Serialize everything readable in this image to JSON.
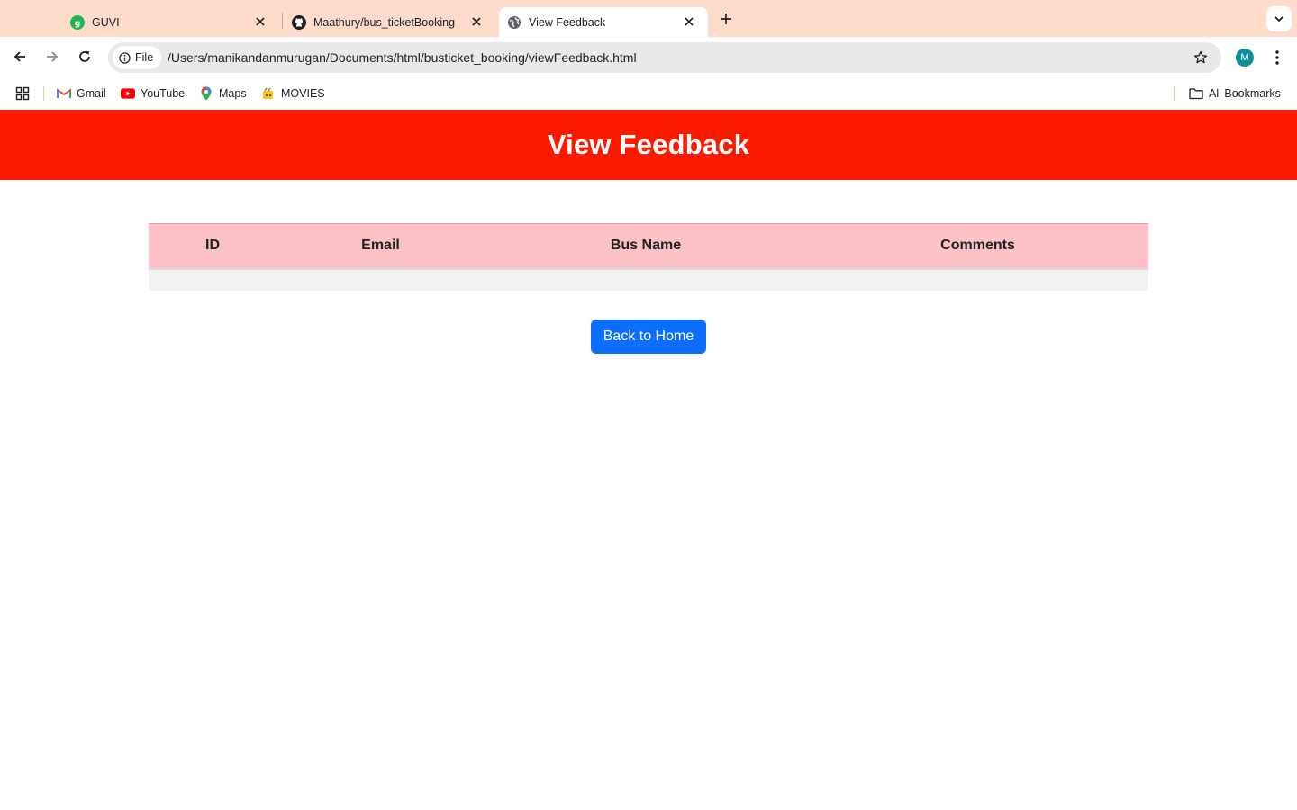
{
  "browser": {
    "tabs": [
      {
        "title": "GUVI",
        "icon": "guvi-logo-icon",
        "active": false
      },
      {
        "title": "Maathury/bus_ticketBooking",
        "icon": "github-icon",
        "active": false
      },
      {
        "title": "View Feedback",
        "icon": "globe-icon",
        "active": true
      }
    ],
    "address_bar": {
      "chip_label": "File",
      "url": "/Users/manikandanmurugan/Documents/html/busticket_booking/viewFeedback.html"
    },
    "profile_initial": "M",
    "bookmarks": [
      {
        "label": "Gmail",
        "icon": "gmail-icon"
      },
      {
        "label": "YouTube",
        "icon": "youtube-icon"
      },
      {
        "label": "Maps",
        "icon": "maps-icon"
      },
      {
        "label": "MOVIES",
        "icon": "movies-icon"
      }
    ],
    "all_bookmarks_label": "All Bookmarks"
  },
  "page": {
    "title": "View Feedback",
    "header_color": "#f91a00",
    "table": {
      "columns": [
        "ID",
        "Email",
        "Bus Name",
        "Comments"
      ],
      "rows": []
    },
    "back_button_label": "Back to Home",
    "button_color": "#0d6efd"
  }
}
